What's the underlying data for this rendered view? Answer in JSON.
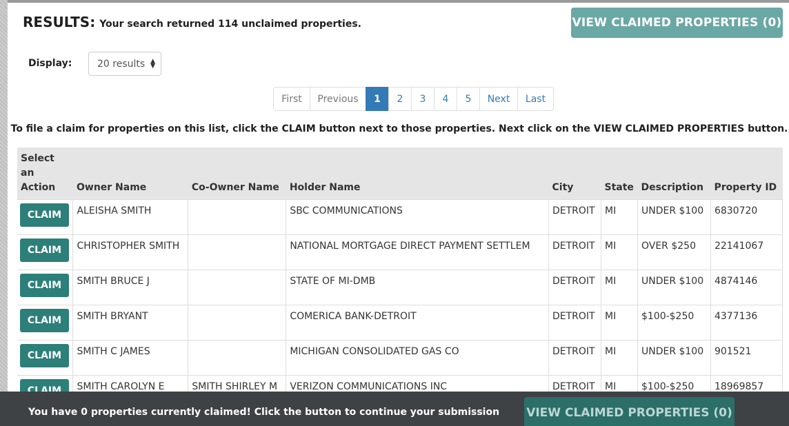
{
  "header": {
    "results_label": "RESULTS:",
    "results_text": "Your search returned 114 unclaimed properties.",
    "view_claimed_top": "VIEW CLAIMED PROPERTIES (0)"
  },
  "display": {
    "label": "Display:",
    "selected": "20 results"
  },
  "pagination": {
    "first": "First",
    "previous": "Previous",
    "pages": [
      "1",
      "2",
      "3",
      "4",
      "5"
    ],
    "active_page": "1",
    "next": "Next",
    "last": "Last"
  },
  "instruction": "To file a claim for properties on this list, click the CLAIM button next to those properties. Next click on the VIEW CLAIMED PROPERTIES button.",
  "table": {
    "headers": {
      "action_line1": "Select an",
      "action_line2": "Action",
      "owner": "Owner Name",
      "coowner": "Co-Owner Name",
      "holder": "Holder Name",
      "city": "City",
      "state": "State",
      "description": "Description",
      "property_id": "Property ID"
    },
    "claim_label": "CLAIM",
    "rows": [
      {
        "owner": "ALEISHA SMITH",
        "coowner": "",
        "holder": "SBC COMMUNICATIONS",
        "city": "DETROIT",
        "state": "MI",
        "description": "UNDER $100",
        "property_id": "6830720"
      },
      {
        "owner": "CHRISTOPHER SMITH",
        "coowner": "",
        "holder": "NATIONAL MORTGAGE DIRECT PAYMENT SETTLEM",
        "city": "DETROIT",
        "state": "MI",
        "description": "OVER $250",
        "property_id": "22141067"
      },
      {
        "owner": "SMITH BRUCE J",
        "coowner": "",
        "holder": "STATE OF MI-DMB",
        "city": "DETROIT",
        "state": "MI",
        "description": "UNDER $100",
        "property_id": "4874146"
      },
      {
        "owner": "SMITH BRYANT",
        "coowner": "",
        "holder": "COMERICA BANK-DETROIT",
        "city": "DETROIT",
        "state": "MI",
        "description": "$100-$250",
        "property_id": "4377136"
      },
      {
        "owner": "SMITH C JAMES",
        "coowner": "",
        "holder": "MICHIGAN CONSOLIDATED GAS CO",
        "city": "DETROIT",
        "state": "MI",
        "description": "UNDER $100",
        "property_id": "901521"
      },
      {
        "owner": "SMITH CAROLYN E",
        "coowner": "SMITH SHIRLEY M",
        "holder": "VERIZON COMMUNICATIONS INC",
        "city": "DETROIT",
        "state": "MI",
        "description": "$100-$250",
        "property_id": "18969857"
      }
    ]
  },
  "footer": {
    "text": "You have 0 properties currently claimed! Click the button to continue your submission",
    "view_claimed_bottom": "VIEW CLAIMED PROPERTIES (0)"
  },
  "colors": {
    "claim_button": "#2d7f79",
    "view_button_top": "#6aa8a5",
    "view_button_bottom": "#2c6e68",
    "pager_active": "#337ab7",
    "footer_bg": "#3e4245"
  }
}
